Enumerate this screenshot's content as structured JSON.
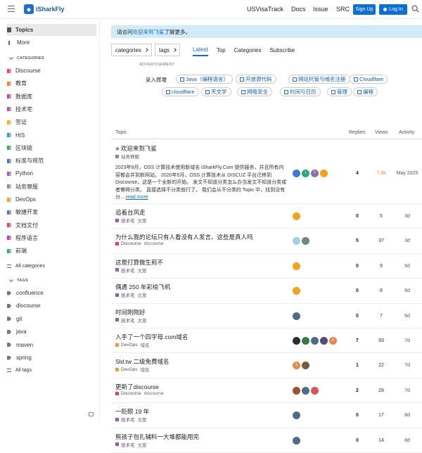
{
  "header": {
    "site_name": "iSharkFly",
    "links": [
      "USVisaTrack",
      "Docs",
      "Issue",
      "SRC"
    ],
    "signup_label": "Sign Up",
    "login_label": "Log In"
  },
  "sidebar": {
    "top_items": [
      {
        "label": "Topics",
        "active": true
      },
      {
        "label": "More",
        "active": false
      }
    ],
    "categories_header": "CATEGORIES",
    "categories": [
      {
        "label": "Discourse",
        "color": "#e8415a"
      },
      {
        "label": "教育",
        "color": "#f2762e"
      },
      {
        "label": "数据库",
        "color": "#c33e9c"
      },
      {
        "label": "技术宅",
        "color": "#9b59b6"
      },
      {
        "label": "签证",
        "color": "#e7b414"
      },
      {
        "label": "HIS",
        "color": "#1e9de0"
      },
      {
        "label": "区块链",
        "color": "#3aa552"
      },
      {
        "label": "标准与规范",
        "color": "#2f7cb7"
      },
      {
        "label": "Python",
        "color": "#8e5bc8"
      },
      {
        "label": "站务察服",
        "color": "#8a8a8a"
      },
      {
        "label": "DevOps",
        "color": "#f39a2c"
      },
      {
        "label": "敏捷开发",
        "color": "#5b6acd"
      },
      {
        "label": "文档文付",
        "color": "#d33f6a"
      },
      {
        "label": "程序语言",
        "color": "#b23ab8"
      },
      {
        "label": "前端",
        "color": "#2aa876"
      }
    ],
    "all_categories_label": "All categories",
    "tags_header": "TAGS",
    "tags": [
      "confluence",
      "discourse",
      "git",
      "java",
      "maven",
      "spring"
    ],
    "all_tags_label": "All tags"
  },
  "banner": {
    "prefix": "请访问 ",
    "link": "欢迎来到飞鲨",
    "suffix": " 了解更多。"
  },
  "nav": {
    "categories_dropdown": "categories",
    "tags_dropdown": "tags",
    "tabs": [
      {
        "label": "Latest",
        "active": true
      },
      {
        "label": "Top",
        "active": false
      },
      {
        "label": "Categories",
        "active": false
      },
      {
        "label": "Subscribe",
        "active": false
      }
    ]
  },
  "advertisement_label": "ADVERTISEMENT",
  "promo": {
    "prefix": "采入挥堰",
    "pills": [
      "Java（编程语言）",
      "开放源代码",
      "网站托管与域名注册",
      "Cloudflare",
      "cloudflare",
      "天文学",
      "网络安全",
      "时间与日历",
      "管理",
      "编程"
    ]
  },
  "table_headers": {
    "topic": "Topic",
    "replies": "Replies",
    "views": "Views",
    "activity": "Activity"
  },
  "topics": [
    {
      "title": "欢迎来到飞鲨",
      "pinned": true,
      "category": "站务察服",
      "cat_color": "#8a8a8a",
      "tags": [],
      "excerpt": "2023年9月，OSS 计算技术使用新域名 iSharkFly.Com 提供服务，并且所有内容都会并到新网站。 2020年5月，OSS 计算技术从 DISCUZ 平台迁移到 Discourse，这是一个全新的开始。 发文不知道分类怎么办当发文不知道分类或者懒得分类， 直接选择不分类就行了。 我们会从不分类的 Topic 中，找到没有分...",
      "read_more": "read more",
      "posters": [
        "#3a7bd5",
        "#2aa876",
        "#8a6fb0",
        "#f3a21c"
      ],
      "poster_letters": [
        "",
        "I",
        "T",
        ""
      ],
      "replies": "4",
      "views": "7.6k",
      "views_hot": true,
      "activity": "May 2025"
    },
    {
      "title": "追着台风走",
      "category": "技术宅",
      "cat_color": "#9b59b6",
      "tags": [
        "文旅"
      ],
      "posters": [
        "#f3a21c"
      ],
      "poster_letters": [
        ""
      ],
      "replies": "0",
      "views": "5",
      "activity": "3d"
    },
    {
      "title": "为什么我的论坛只有人看没有人发言、这些是真人吗",
      "category": "Discourse",
      "cat_color": "#e8415a",
      "tags": [
        "discourse"
      ],
      "posters": [
        "#9fd0e3",
        "#6d8b74"
      ],
      "poster_letters": [
        "",
        ""
      ],
      "replies": "5",
      "views": "37",
      "activity": "3d"
    },
    {
      "title": "这是打算做生煎不",
      "category": "技术宅",
      "cat_color": "#9b59b6",
      "tags": [
        "文旅"
      ],
      "posters": [
        "#f3a21c"
      ],
      "poster_letters": [
        ""
      ],
      "replies": "0",
      "views": "9",
      "activity": "6d"
    },
    {
      "title": "偶遇 250 年彩绘飞机",
      "category": "技术宅",
      "cat_color": "#9b59b6",
      "tags": [
        "文旅"
      ],
      "posters": [
        "#f3a21c"
      ],
      "poster_letters": [
        ""
      ],
      "replies": "0",
      "views": "8",
      "activity": "6d"
    },
    {
      "title": "时间刚刚好",
      "category": "技术宅",
      "cat_color": "#9b59b6",
      "tags": [
        "文旅"
      ],
      "posters": [
        "#4d6b8a"
      ],
      "poster_letters": [
        ""
      ],
      "replies": "0",
      "views": "7",
      "activity": "6d"
    },
    {
      "title": "入手了一个四字母.com域名",
      "category": "DevOps",
      "cat_color": "#f39a2c",
      "tags": [
        "域名"
      ],
      "posters": [
        "#2d2d2d",
        "#3c7a3a",
        "#4d6b8a",
        "#5a4a7a",
        "#e5874b"
      ],
      "poster_letters": [
        "",
        "",
        "",
        "",
        "S"
      ],
      "replies": "7",
      "views": "93",
      "activity": "7d"
    },
    {
      "title": "Sld.tw 二级免费域名",
      "category": "DevOps",
      "cat_color": "#f39a2c",
      "tags": [
        "域名"
      ],
      "posters": [
        "#e5874b",
        "#7a5a3a"
      ],
      "poster_letters": [
        "S",
        ""
      ],
      "replies": "1",
      "views": "22",
      "activity": "7d"
    },
    {
      "title": "更新了discourse",
      "category": "Discourse",
      "cat_color": "#e8415a",
      "tags": [
        "discourse"
      ],
      "posters": [
        "#a0522d",
        "#4d6b8a",
        "#d9534f"
      ],
      "poster_letters": [
        "",
        "",
        ""
      ],
      "replies": "2",
      "views": "28",
      "activity": "7d"
    },
    {
      "title": "一眨眼 19 年",
      "category": "技术宅",
      "cat_color": "#9b59b6",
      "tags": [
        "文旅"
      ],
      "posters": [
        "#4d6b8a"
      ],
      "poster_letters": [
        ""
      ],
      "replies": "0",
      "views": "17",
      "activity": "8d"
    },
    {
      "title": "熊孩子包扎辅料一大堆都能用完",
      "category": "技术宅",
      "cat_color": "#9b59b6",
      "tags": [
        "文旅"
      ],
      "posters": [
        "#4d6b8a"
      ],
      "poster_letters": [
        ""
      ],
      "replies": "0",
      "views": "14",
      "activity": "8d"
    }
  ]
}
